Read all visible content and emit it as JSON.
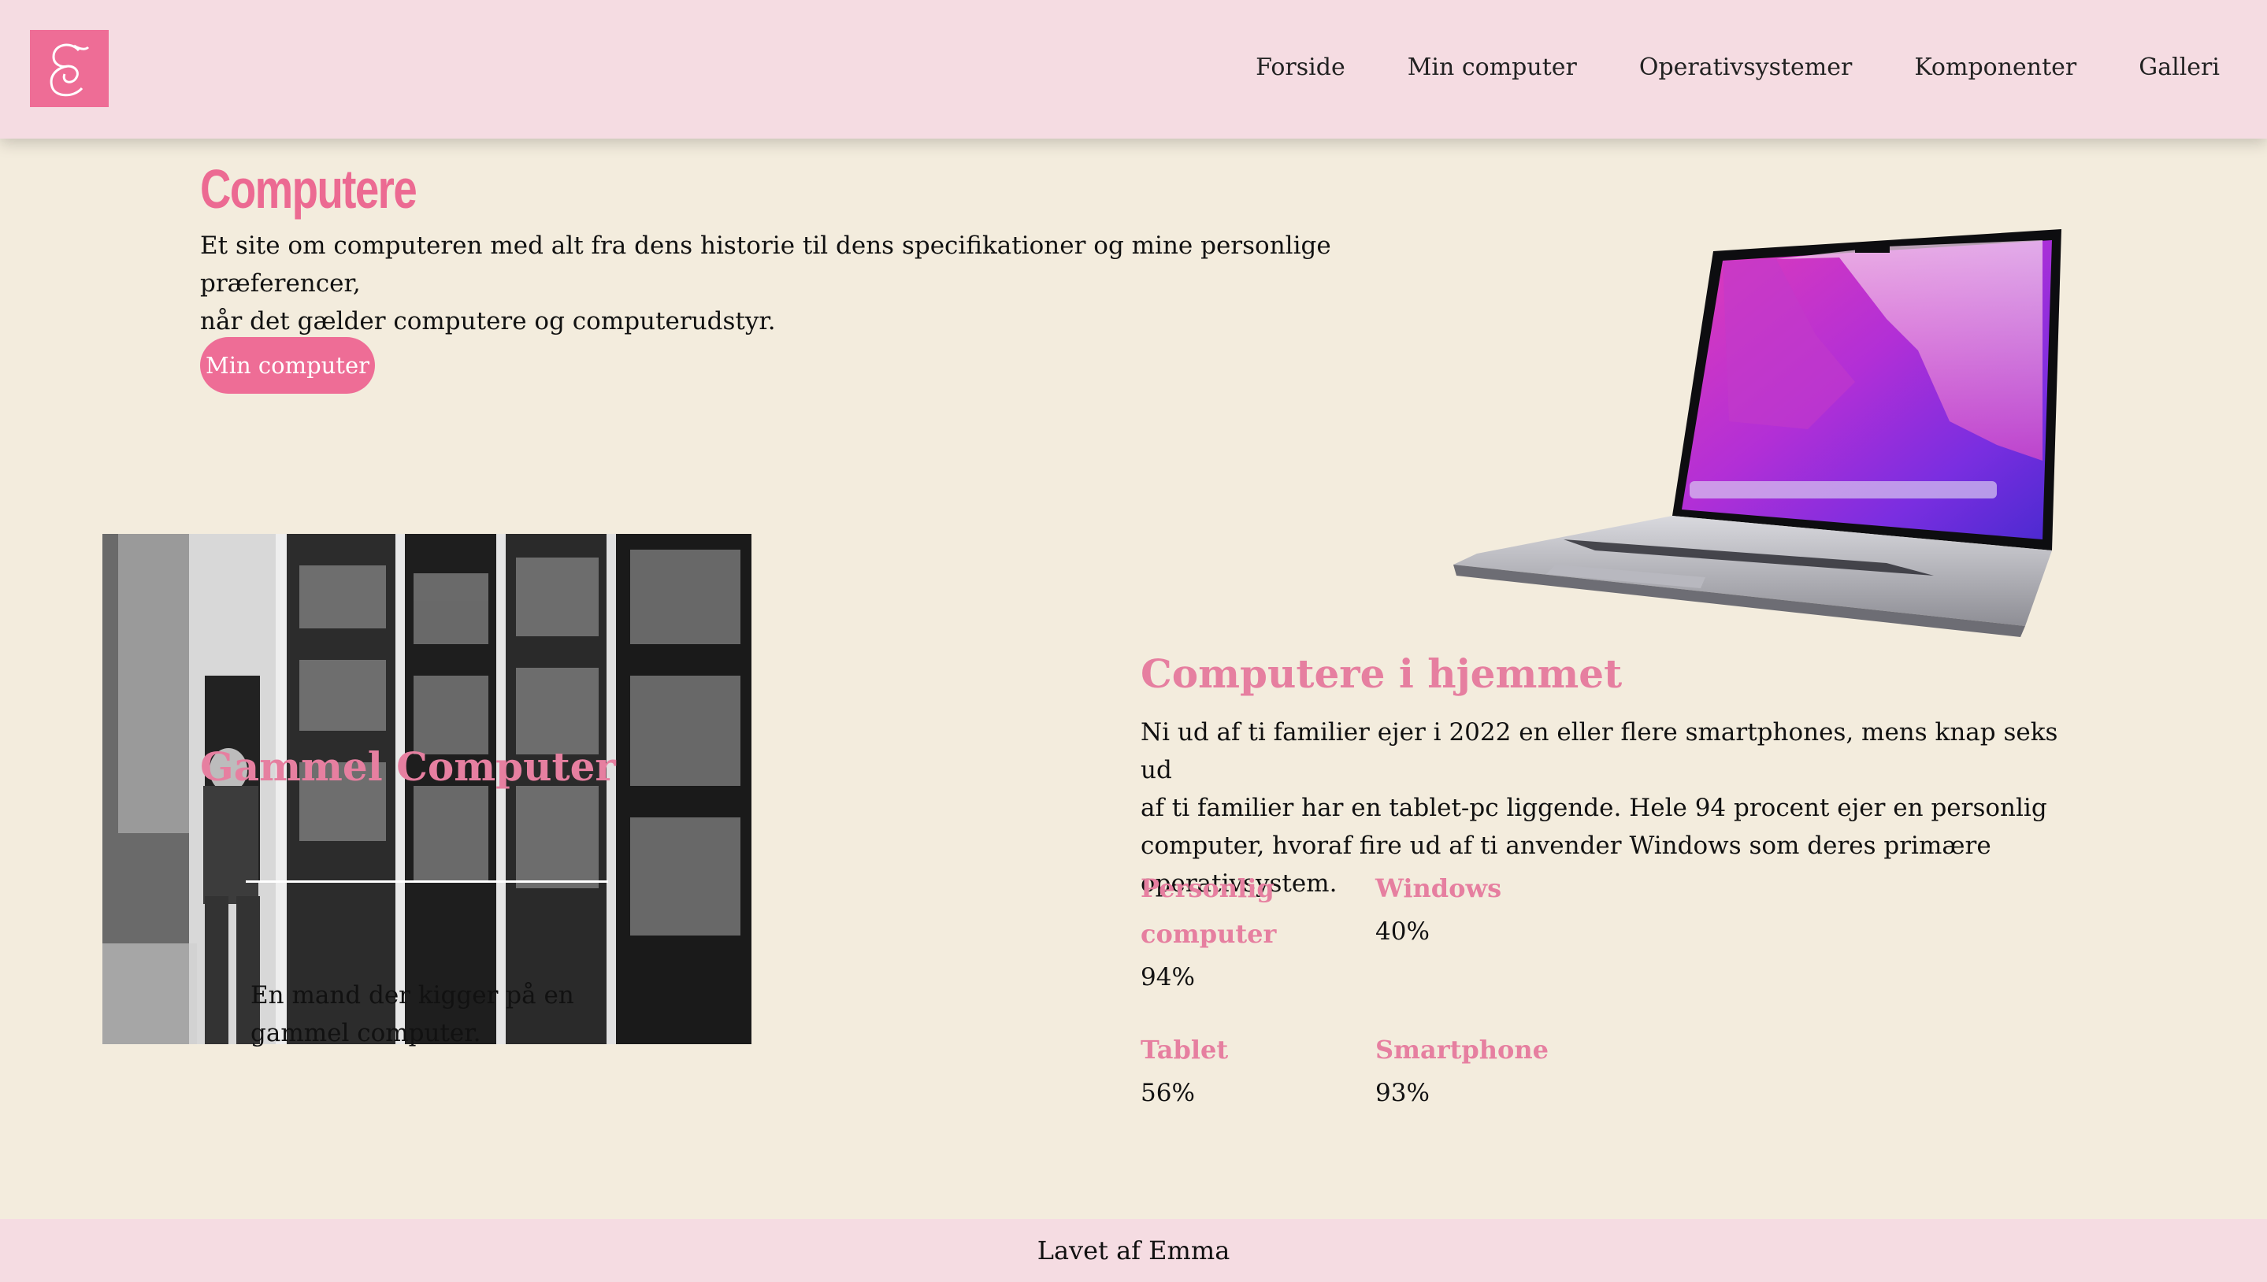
{
  "header": {
    "logo_icon": "script-e-logo-icon",
    "nav": [
      "Forside",
      "Min computer",
      "Operativsystemer",
      "Komponenter",
      "Galleri"
    ]
  },
  "hero": {
    "title": "Computere",
    "text_line1": "Et site om computeren med alt fra dens historie til dens specifikationer og mine personlige præferencer,",
    "text_line2": "når det gælder computere og computerudstyr.",
    "button": "Min computer"
  },
  "old_computer": {
    "title": "Gammel Computer",
    "caption_line1": "En mand der kigger på en",
    "caption_line2": "gammel computer."
  },
  "home": {
    "title": "Computere i hjemmet",
    "lines": [
      "Ni ud af ti familier ejer i 2022 en eller flere smartphones, mens knap seks ud",
      "af ti familier har en tablet-pc liggende. Hele 94 procent ejer en personlig",
      "computer, hvoraf fire ud af ti anvender Windows som deres primære",
      "operativsystem."
    ],
    "stats": [
      {
        "label_line1": "Personlig",
        "label_line2": "computer",
        "value": "94%"
      },
      {
        "label_line1": "Windows",
        "label_line2": "",
        "value": "40%"
      },
      {
        "label_line1": "Tablet",
        "label_line2": "",
        "value": "56%"
      },
      {
        "label_line1": "Smartphone",
        "label_line2": "",
        "value": "93%"
      }
    ]
  },
  "footer": {
    "text": "Lavet af Emma"
  },
  "colors": {
    "accent": "#ee6d96",
    "heading_pink": "#e67fa0",
    "header_bg": "#f5dce2",
    "page_bg": "#f3ecdd"
  }
}
